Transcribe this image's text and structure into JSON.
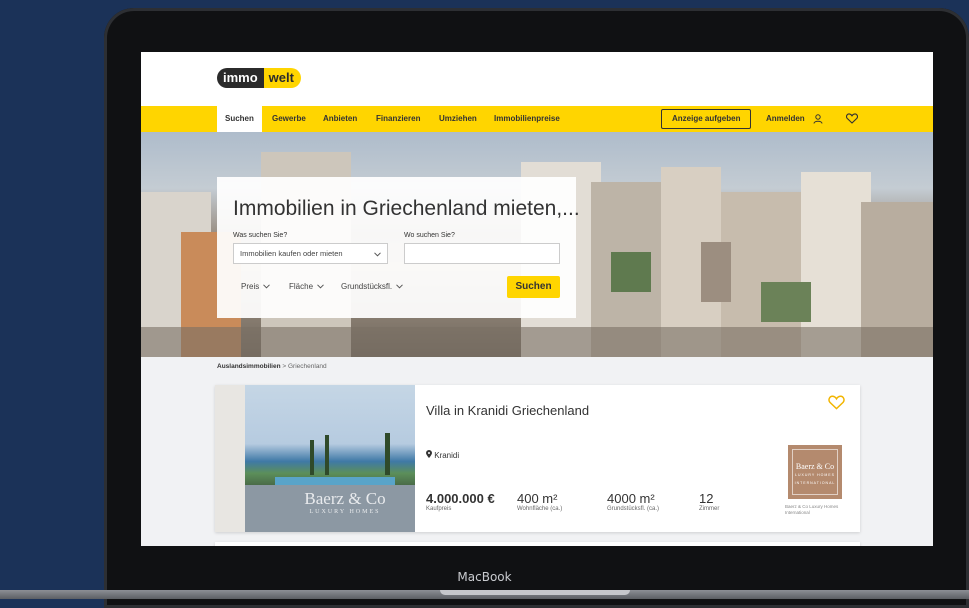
{
  "brand": {
    "logo_left": "immo",
    "logo_right": "welt",
    "accent": "#ffd500"
  },
  "nav": {
    "items": [
      "Suchen",
      "Gewerbe",
      "Anbieten",
      "Finanzieren",
      "Umziehen",
      "Immobilienpreise"
    ],
    "cta": "Anzeige aufgeben",
    "login": "Anmelden"
  },
  "search": {
    "title": "Immobilien in Griechenland mieten,...",
    "what_label": "Was suchen Sie?",
    "what_value": "Immobilien kaufen oder mieten",
    "where_label": "Wo suchen Sie?",
    "where_value": "",
    "filters": [
      "Preis",
      "Fläche",
      "Grundstücksfl."
    ],
    "button": "Suchen"
  },
  "breadcrumb": {
    "root": "Auslandsimmobilien",
    "separator": ">",
    "current": "Griechenland"
  },
  "listing": {
    "title": "Villa in Kranidi Griechenland",
    "location": "Kranidi",
    "price": "4.000.000 €",
    "price_label": "Kaufpreis",
    "living_area": "400 m²",
    "living_area_label": "Wohnfläche (ca.)",
    "plot_area": "4000 m²",
    "plot_area_label": "Grundstücksfl. (ca.)",
    "rooms": "12",
    "rooms_label": "Zimmer",
    "watermark_line1": "Baerz & Co",
    "watermark_line2": "LUXURY HOMES",
    "agent_logo_line1": "Baerz & Co",
    "agent_logo_line2": "LUXURY HOMES",
    "agent_logo_line3": "INTERNATIONAL",
    "agent_name": "Baerz & Co Luxury Homes International"
  },
  "device": {
    "label": "MacBook"
  }
}
